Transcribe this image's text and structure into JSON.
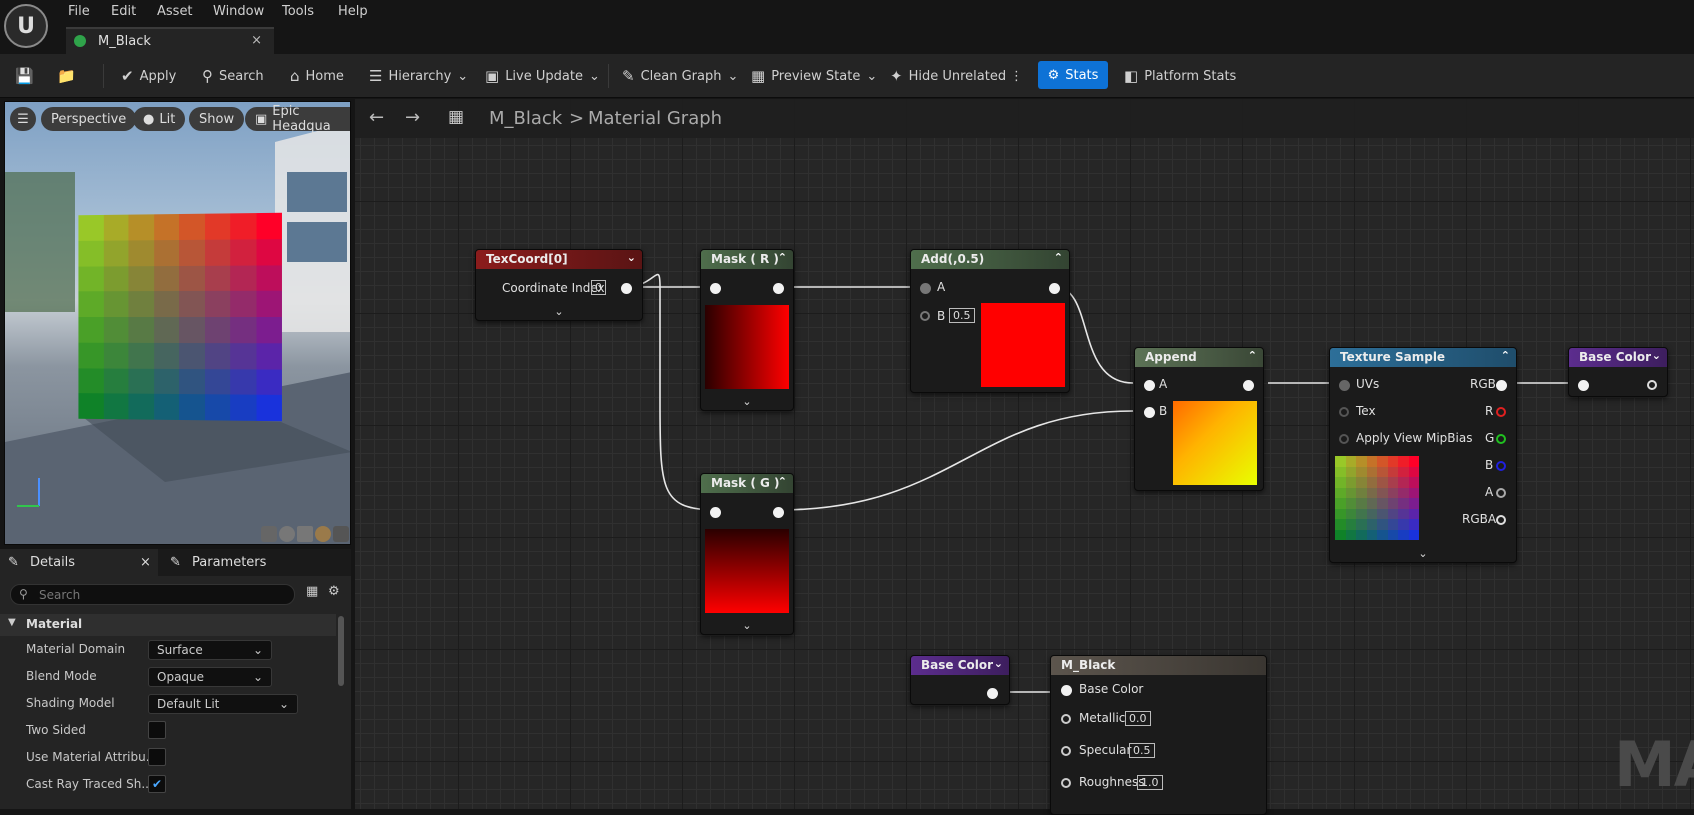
{
  "menubar": {
    "items": [
      "File",
      "Edit",
      "Asset",
      "Window",
      "Tools",
      "Help"
    ]
  },
  "tab": {
    "title": "M_Black",
    "close": "×"
  },
  "toolbar": {
    "apply": "Apply",
    "search": "Search",
    "home": "Home",
    "hierarchy": "Hierarchy",
    "live_update": "Live Update",
    "clean_graph": "Clean Graph",
    "preview_state": "Preview State",
    "hide_unrelated": "Hide Unrelated",
    "stats": "Stats",
    "platform_stats": "Platform Stats"
  },
  "viewport": {
    "perspective": "Perspective",
    "lit": "Lit",
    "show": "Show",
    "environment": "Epic Headqua"
  },
  "details": {
    "tab_details": "Details",
    "tab_parameters": "Parameters",
    "close": "×",
    "search_placeholder": "Search",
    "section": "Material",
    "properties": [
      {
        "label": "Material Domain",
        "value": "Surface"
      },
      {
        "label": "Blend Mode",
        "value": "Opaque"
      },
      {
        "label": "Shading Model",
        "value": "Default Lit"
      },
      {
        "label": "Two Sided",
        "checked": false
      },
      {
        "label": "Use Material Attribu...",
        "checked": false
      },
      {
        "label": "Cast Ray Traced Sh...",
        "checked": true
      }
    ]
  },
  "graph": {
    "breadcrumb_asset": "M_Black",
    "breadcrumb_sep": ">",
    "breadcrumb_graph": "Material Graph",
    "watermark": "MA",
    "nodes": {
      "texcoord": {
        "title": "TexCoord[0]",
        "pin": "Coordinate Index",
        "value": "0"
      },
      "mask_r": {
        "title": "Mask ( R )"
      },
      "mask_g": {
        "title": "Mask ( G )"
      },
      "add": {
        "title": "Add(,0.5)",
        "pin_a": "A",
        "pin_b": "B",
        "b_value": "0.5"
      },
      "append": {
        "title": "Append",
        "pin_a": "A",
        "pin_b": "B"
      },
      "texsample": {
        "title": "Texture Sample",
        "uvs": "UVs",
        "tex": "Tex",
        "mip": "Apply View MipBias",
        "rgb": "RGB",
        "r": "R",
        "g": "G",
        "b": "B",
        "a": "A",
        "rgba": "RGBA"
      },
      "reroute1": {
        "title": "Base Color"
      },
      "reroute2": {
        "title": "Base Color"
      },
      "result": {
        "title": "M_Black",
        "base_color": "Base Color",
        "metallic": "Metallic",
        "metallic_value": "0.0",
        "specular": "Specular",
        "specular_value": "0.5",
        "roughness": "Roughness",
        "roughness_value": "1.0"
      }
    }
  },
  "colors": {
    "accent": "#0e72d6",
    "texcoord_header": "#8b1c1c",
    "mask_header": "#4f6e4c",
    "append_header": "#5c7356",
    "texsample_header": "#2d6f99",
    "basecolor_header": "#5c2d8e",
    "result_header": "#5c554d"
  },
  "icons": [
    "unreal-logo-icon",
    "save-icon",
    "browse-icon",
    "apply-icon",
    "search-icon",
    "home-icon",
    "hierarchy-icon",
    "live-update-icon",
    "clean-graph-icon",
    "preview-state-icon",
    "hide-unrelated-icon",
    "stats-icon",
    "platform-stats-icon"
  ]
}
